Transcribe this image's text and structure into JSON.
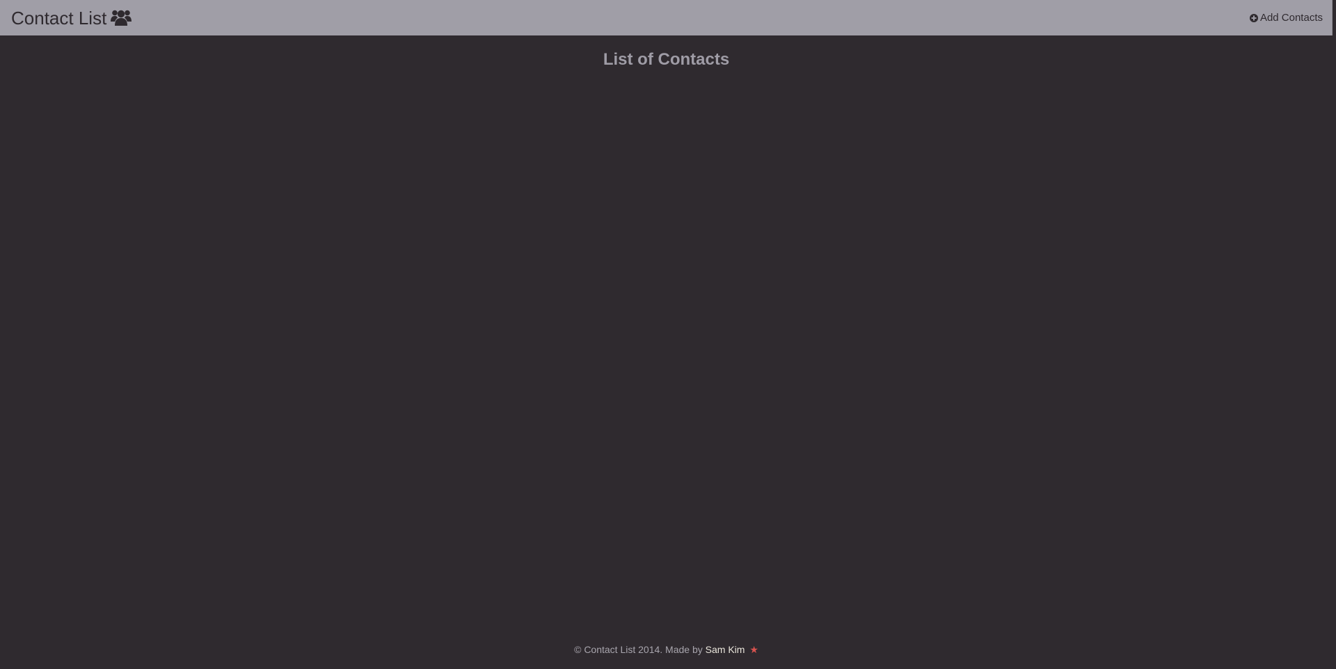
{
  "navbar": {
    "brand_label": "Contact List",
    "brand_icon": "users-icon",
    "add_label": "Add Contacts",
    "add_icon": "plus-circle-icon"
  },
  "main": {
    "title": "List of Contacts"
  },
  "footer": {
    "copyright_text": "© Contact List 2014. Made by",
    "author_name": "Sam Kim",
    "star_glyph": "★"
  },
  "colors": {
    "navbar_bg": "#a09ea7",
    "page_bg": "#2f2a2f",
    "accent_star": "#d9534f"
  }
}
